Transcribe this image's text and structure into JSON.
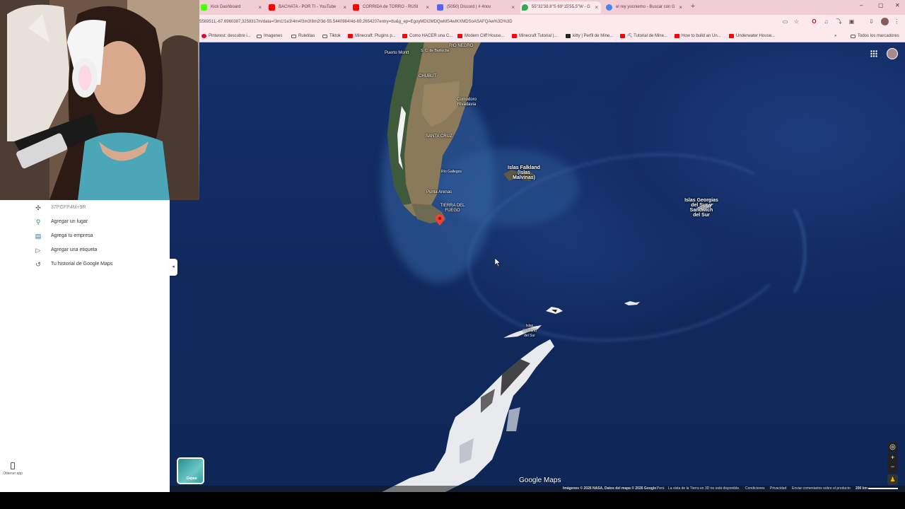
{
  "tabs": [
    {
      "label": "Kick Dashboard",
      "icon_color": "#53fc18",
      "close": "×"
    },
    {
      "label": "BACHATA - POR TI - YouTube",
      "icon_color": "#ff0000",
      "close": "×"
    },
    {
      "label": "CORRIDA de TORRO - RUSI",
      "icon_color": "#ff0000",
      "close": "×"
    },
    {
      "label": "(5050) Discord | # 4nov",
      "icon_color": "#5865f2",
      "close": "×"
    },
    {
      "label": "55°32'38.8\"S 69°15'55.5\"W - G",
      "icon_color": "#34a853",
      "close": "×"
    },
    {
      "label": "el rey yusniemo - Buscar con G",
      "icon_color": "#4285f4",
      "close": "×"
    }
  ],
  "new_tab": "+",
  "window_controls": {
    "minimize": "–",
    "maximize": "▢",
    "close": "✕"
  },
  "url": "5569511,-67.6960387,3258317m/data=!3m1!1e3!4m4!3m3!8m2!3d-55.5440984!4d-69.2654207entry=ttu&g_ep=EgoyMDI2MDQwMS4wIKXMDSoASAFQAw%3D%3D",
  "bookmarks": [
    {
      "label": "Pinterest: descubre i...",
      "icon": "pinterest-icon",
      "color": "#e60023"
    },
    {
      "label": "Imagenes",
      "icon": "folder-icon",
      "color": ""
    },
    {
      "label": "Ruletitas",
      "icon": "folder-icon",
      "color": ""
    },
    {
      "label": "Tiktok",
      "icon": "folder-icon",
      "color": ""
    },
    {
      "label": "Minecraft: Plugins p...",
      "icon": "youtube-icon",
      "color": "#ff0000"
    },
    {
      "label": "Como HACER una C...",
      "icon": "youtube-icon",
      "color": "#ff0000"
    },
    {
      "label": "Modern Cliff House...",
      "icon": "youtube-icon",
      "color": "#ff0000"
    },
    {
      "label": "Minecraft Tutorial |...",
      "icon": "youtube-icon",
      "color": "#ff0000"
    },
    {
      "label": "kitty | Perfil de Mine...",
      "icon": "site-icon",
      "color": "#222222"
    },
    {
      "label": "⛏ Tutorial de Mine...",
      "icon": "youtube-icon",
      "color": "#ff0000"
    },
    {
      "label": "How to build an Un...",
      "icon": "youtube-icon",
      "color": "#ff0000"
    },
    {
      "label": "Underwater House...",
      "icon": "youtube-icon",
      "color": "#ff0000"
    }
  ],
  "all_bookmarks": "Todos los marcadores",
  "left_panel": {
    "items": [
      {
        "label": "37PGFP4M+9R",
        "icon": "plus-code-icon"
      },
      {
        "label": "Agregar un lugar",
        "icon": "add-place-icon"
      },
      {
        "label": "Agrega tu empresa",
        "icon": "store-icon"
      },
      {
        "label": "Agregar una etiqueta",
        "icon": "label-icon"
      },
      {
        "label": "Tu historial de Google Maps",
        "icon": "history-icon"
      }
    ],
    "get_app": "Obtener app"
  },
  "map": {
    "labels": {
      "rio_negro": "RIO NEGRO",
      "puerto_montt": "Puerto Montt",
      "bariloche": "S. C. de Bariloche",
      "chubut": "CHUBUT",
      "comodoro": "Comodoro Rivadavia",
      "santa_cruz": "SANTA CRUZ",
      "rio_gallegos": "Río Gallegos",
      "punta_arenas": "Punta Arenas",
      "tierra_del_fuego": "TIERRA DEL FUEGO",
      "falkland_1": "Islas Falkland",
      "falkland_2": "(Islas",
      "falkland_3": "Malvinas)",
      "georgias_1": "Islas Georgias",
      "georgias_2": "del Sur y",
      "georgias_3": "Sandwich",
      "georgias_4": "del Sur",
      "orcadas": "Islas Orcadas del Sur",
      "shetland": "Islas Shetland del Sur"
    },
    "layers_label": "Capas",
    "google_maps": "Google Maps",
    "zoom_in": "+",
    "zoom_out": "−"
  },
  "attribution": {
    "imagery": "Imágenes © 2026 NASA, Datos del mapa © 2026 Google",
    "country": "Perú",
    "earth3d": "La vista de la Tierra en 3D no está disponible.",
    "terms": "Condiciones",
    "privacy": "Privacidad",
    "feedback": "Enviar comentarios sobre el producto",
    "scale": "200 km"
  }
}
